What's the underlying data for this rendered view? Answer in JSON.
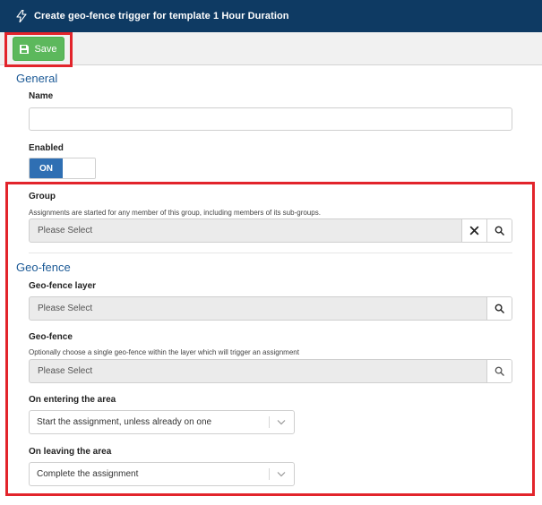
{
  "header": {
    "title": "Create geo-fence trigger for template 1 Hour Duration",
    "icon": "lightning-bolt-icon",
    "background": "#0e3a63"
  },
  "toolbar": {
    "save_label": "Save",
    "save_icon": "floppy-disk-icon",
    "save_color": "#5cb85c"
  },
  "sections": {
    "general_title": "General",
    "geofence_title": "Geo-fence"
  },
  "form": {
    "name": {
      "label": "Name",
      "value": ""
    },
    "enabled": {
      "label": "Enabled",
      "state": "ON"
    },
    "group": {
      "label": "Group",
      "help": "Assignments are started for any member of this group, including members of its sub-groups.",
      "placeholder": "Please Select"
    },
    "geofence_layer": {
      "label": "Geo-fence layer",
      "placeholder": "Please Select"
    },
    "geofence": {
      "label": "Geo-fence",
      "help": "Optionally choose a single geo-fence within the layer which will trigger an assignment",
      "placeholder": "Please Select"
    },
    "on_entering": {
      "label": "On entering the area",
      "value": "Start the assignment, unless already on one"
    },
    "on_leaving": {
      "label": "On leaving the area",
      "value": "Complete the assignment"
    }
  },
  "colors": {
    "accent": "#1c5a96",
    "toggle_on": "#2f6fb3",
    "highlight": "#e2242b"
  }
}
